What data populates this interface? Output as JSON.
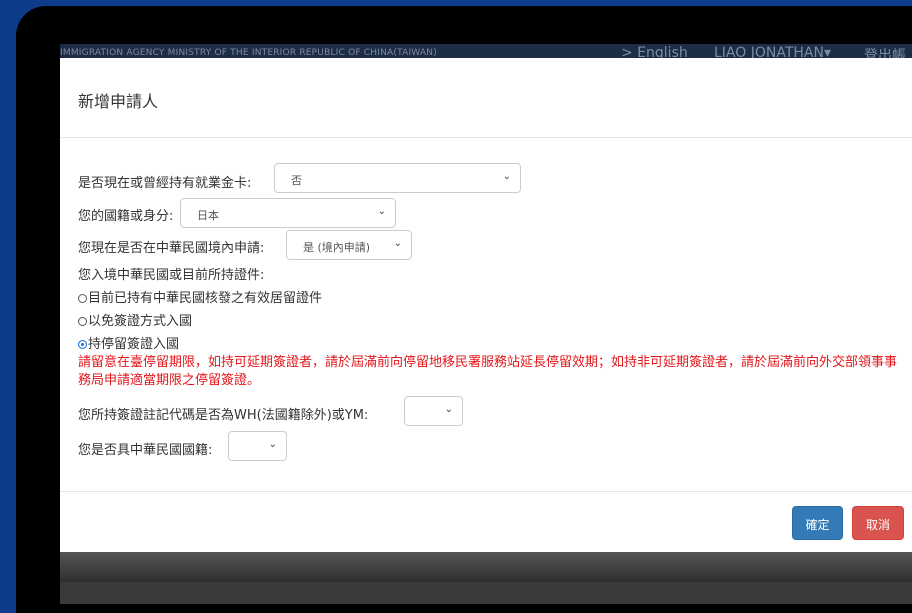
{
  "topbar": {
    "agency": "IMMIGRATION AGENCY MINISTRY OF THE INTERIOR REPUBLIC OF CHINA(TAIWAN)",
    "language": "> English",
    "user": "LIAO JONATHAN▾",
    "logout": "登出帳"
  },
  "modal": {
    "title": "新增申請人",
    "q_gold_card": {
      "label": "是否現在或曾經持有就業金卡:",
      "value": "否"
    },
    "q_nationality": {
      "label": "您的國籍或身分:",
      "value": "日本"
    },
    "q_in_taiwan": {
      "label": "您現在是否在中華民國境內申請:",
      "value": "是 (境內申請)"
    },
    "q_document": {
      "label": "您入境中華民國或目前所持證件:",
      "options": [
        "目前已持有中華民國核發之有效居留證件",
        "以免簽證方式入國",
        "持停留簽證入國"
      ],
      "selected_index": 2
    },
    "warning": "請留意在臺停留期限，如持可延期簽證者，請於屆滿前向停留地移民署服務站延長停留效期；如持非可延期簽證者，請於屆滿前向外交部領事事務局申請適當期限之停留簽證。",
    "q_visa_code": {
      "label": "您所持簽證註記代碼是否為WH(法國籍除外)或YM:",
      "value": ""
    },
    "q_roc_nationality": {
      "label": "您是否具中華民國國籍:",
      "value": ""
    },
    "ok_label": "確定",
    "cancel_label": "取消"
  }
}
